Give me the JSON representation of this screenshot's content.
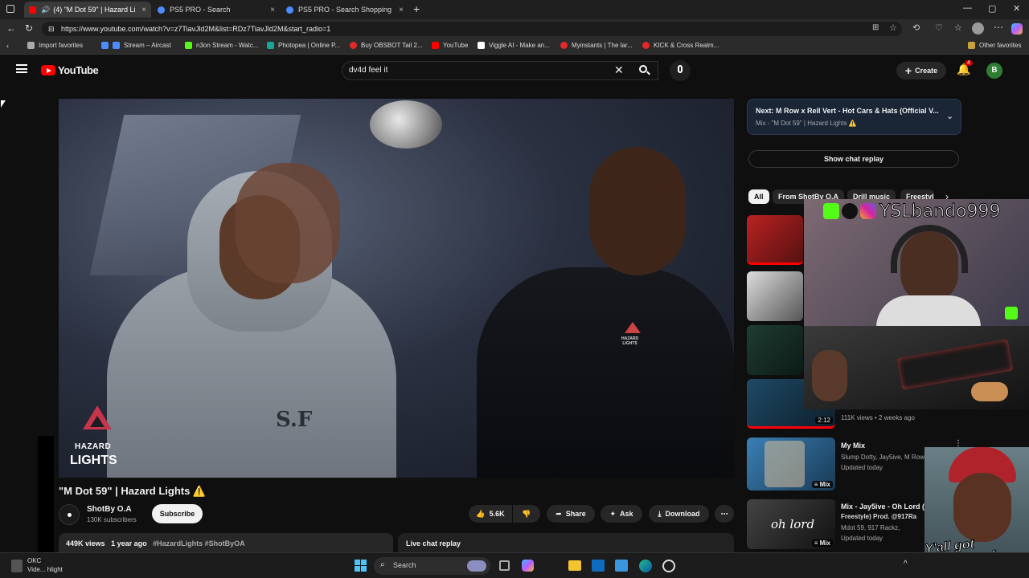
{
  "browser": {
    "tabs": [
      {
        "label": "(4) \"M Dot 59\" | Hazard Light",
        "close": "×"
      },
      {
        "label": "PS5 PRO - Search",
        "close": "×"
      },
      {
        "label": "PS5 PRO - Search Shopping",
        "close": "×"
      }
    ],
    "new_tab": "+",
    "window_controls": {
      "minimize": "—",
      "maximize": "▢",
      "close": "✕"
    },
    "url": "https://www.youtube.com/watch?v=z7TiavJld2M&list=RDz7TiavJld2M&start_radio=1",
    "bookmarks": [
      {
        "label": "Import favorites",
        "color": "#aaaaaa"
      },
      {
        "label": "Stream – Aircast",
        "color": "#4c8cff"
      },
      {
        "label": "n3on Stream - Watc...",
        "color": "#53fc18"
      },
      {
        "label": "Photopea | Online P...",
        "color": "#18a497"
      },
      {
        "label": "Buy OBSBOT Tail 2...",
        "color": "#e22828"
      },
      {
        "label": "YouTube",
        "color": "#ff0000"
      },
      {
        "label": "Viggle AI - Make an...",
        "color": "#ffffff"
      },
      {
        "label": "Myinstants | The lar...",
        "color": "#e22828"
      },
      {
        "label": "KICK & Cross Realm...",
        "color": "#e22828"
      }
    ],
    "other_favorites": "Other favorites"
  },
  "youtube": {
    "logo_text": "YouTube",
    "search_value": "dv4d feel it",
    "create_label": "Create",
    "notification_count": "4",
    "avatar_letter": "B"
  },
  "video": {
    "title": "\"M Dot 59\" | Hazard Lights ⚠️",
    "watermark_line1": "HAZARD",
    "watermark_line2": "LIGHTS",
    "hoodie_text": "HAZARD\nLIGHTS",
    "channel_name": "ShotBy O.A",
    "subscribers": "130K subscribers",
    "subscribe_label": "Subscribe",
    "likes": "5.6K",
    "share_label": "Share",
    "ask_label": "Ask",
    "download_label": "Download",
    "views": "449K views",
    "age": "1 year ago",
    "hashtags": "#HazardLights #ShotByOA",
    "live_chat_label": "Live chat replay"
  },
  "sidebar": {
    "next_label": "Next:",
    "next_title": "M Row x Rell Vert - Hot Cars & Hats (Official V...",
    "next_meta": "Mix - \"M Dot 59\" | Hazard Lights ⚠️",
    "show_chat_label": "Show chat replay",
    "chips": [
      "All",
      "From ShotBy O.A",
      "Drill music",
      "Freestyl"
    ],
    "items": [
      {
        "duration": "2:12",
        "meta": "111K views • 2 weeks ago"
      },
      {
        "title": "My Mix",
        "line1": "Slump Dotty, Jay5ive, M Row,",
        "line2": "Updated today",
        "badge": "Mix"
      },
      {
        "title": "Mix - Jay5ive - Oh Lord (A",
        "line1": "Freestyle) Prod. @917Ra",
        "line2": "Mdot 59, 917 Rackz,",
        "line3": "Updated today",
        "badge": "Mix",
        "overlay_text": "oh lord"
      }
    ]
  },
  "overlay": {
    "streamer_name": "YSLbando999",
    "meme_text": "Y'all got anymore of them KICK's!!!"
  },
  "taskbar": {
    "search_placeholder": "Search",
    "left_app_line1": "OKC",
    "left_app_line2": "Vide... hlight"
  }
}
